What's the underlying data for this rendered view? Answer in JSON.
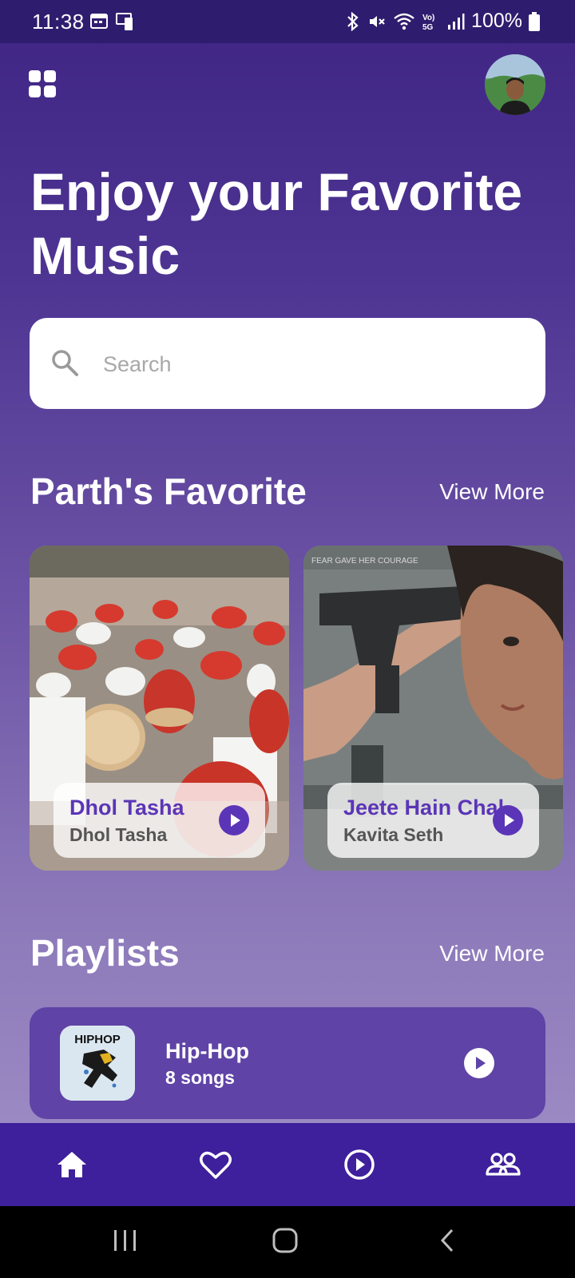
{
  "status_bar": {
    "time": "11:38",
    "battery": "100%"
  },
  "hero": {
    "title": "Enjoy your Favorite Music"
  },
  "search": {
    "placeholder": "Search"
  },
  "favorites": {
    "title": "Parth's Favorite",
    "view_more": "View More",
    "cards": [
      {
        "song": "Dhol Tasha",
        "artist": "Dhol Tasha"
      },
      {
        "song": "Jeete Hain Chal",
        "artist": "Kavita Seth"
      }
    ]
  },
  "playlists": {
    "title": "Playlists",
    "view_more": "View More",
    "items": [
      {
        "name": "Hip-Hop",
        "count": "8 songs",
        "thumb_text": "HIPHOP"
      }
    ]
  },
  "bottom_nav": {
    "items": [
      "home-icon",
      "heart-icon",
      "play-circle-icon",
      "people-icon"
    ],
    "active_color": "#ffffff",
    "background": "#3e1f9c"
  },
  "colors": {
    "accent": "#5b35b7",
    "status_bar": "#2e1d6e"
  }
}
